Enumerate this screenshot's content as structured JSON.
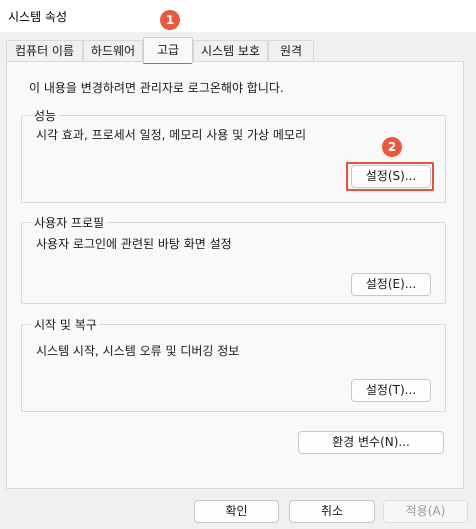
{
  "window": {
    "title": "시스템 속성"
  },
  "tabs": [
    {
      "label": "컴퓨터 이름"
    },
    {
      "label": "하드웨어"
    },
    {
      "label": "고급"
    },
    {
      "label": "시스템 보호"
    },
    {
      "label": "원격"
    }
  ],
  "active_tab": "고급",
  "notice": "이 내용을 변경하려면 관리자로 로그온해야 합니다.",
  "groups": {
    "performance": {
      "title": "성능",
      "description": "시각 효과, 프로세서 일정, 메모리 사용 및 가상 메모리",
      "button": "설정(S)..."
    },
    "user_profiles": {
      "title": "사용자 프로필",
      "description": "사용자 로그인에 관련된 바탕 화면 설정",
      "button": "설정(E)..."
    },
    "startup_recovery": {
      "title": "시작 및 복구",
      "description": "시스템 시작, 시스템 오류 및 디버깅 정보",
      "button": "설정(T)..."
    }
  },
  "env_button": "환경 변수(N)...",
  "footer": {
    "ok": "확인",
    "cancel": "취소",
    "apply": "적용(A)"
  },
  "markers": [
    "1",
    "2"
  ],
  "colors": {
    "highlight": "#e5523f",
    "marker": "#e8593f"
  }
}
